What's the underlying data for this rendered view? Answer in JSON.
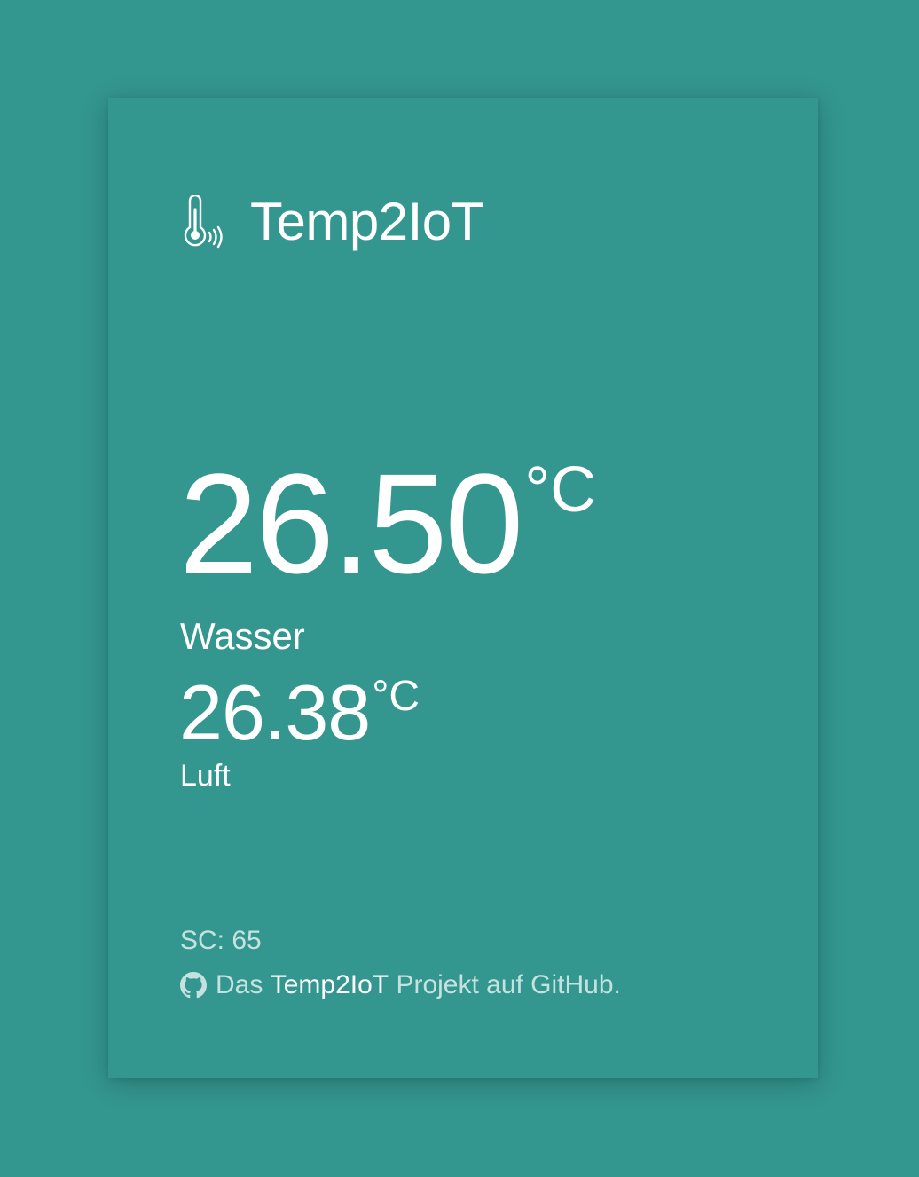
{
  "header": {
    "icon": "thermometer-signal-icon",
    "title": "Temp2IoT"
  },
  "water": {
    "value": "26.50",
    "unit": "°C",
    "label": "Wasser"
  },
  "air": {
    "value": "26.38",
    "unit": "°C",
    "label": "Luft"
  },
  "footer": {
    "sc_text": "SC: 65",
    "github_icon": "github-icon",
    "prefix": "Das",
    "link_text": "Temp2IoT",
    "suffix": "Projekt auf GitHub."
  },
  "colors": {
    "background": "#33968f",
    "text": "#ffffff",
    "muted_text": "rgba(255,255,255,0.72)"
  }
}
